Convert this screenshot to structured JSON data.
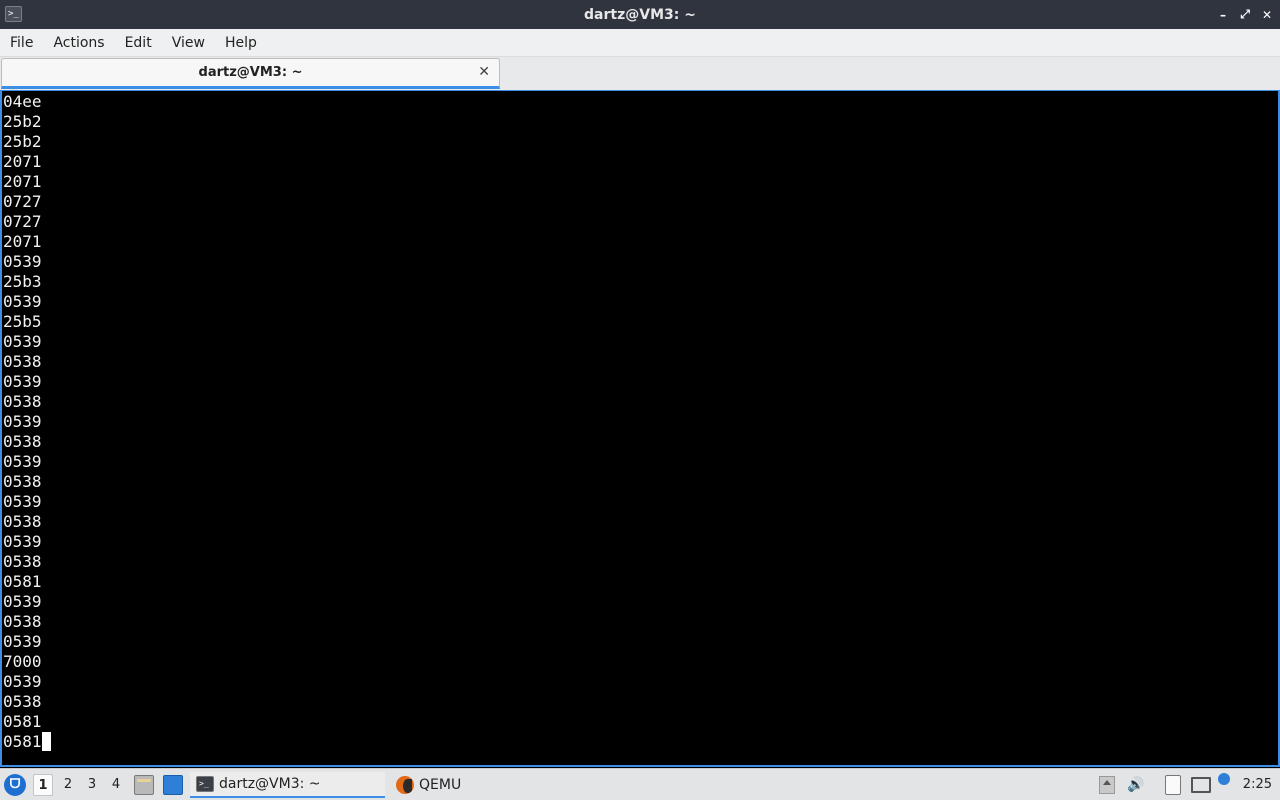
{
  "window": {
    "title": "dartz@VM3: ~",
    "app_icon_glyph": ">_",
    "controls": {
      "minimize": "–",
      "restore": "⤢",
      "close": "✕"
    }
  },
  "menu": [
    "File",
    "Actions",
    "Edit",
    "View",
    "Help"
  ],
  "tab": {
    "label": "dartz@VM3: ~",
    "close": "✕"
  },
  "terminal": {
    "lines": [
      "04ee",
      "25b2",
      "25b2",
      "2071",
      "2071",
      "0727",
      "0727",
      "2071",
      "0539",
      "25b3",
      "0539",
      "25b5",
      "0539",
      "0538",
      "0539",
      "0538",
      "0539",
      "0538",
      "0539",
      "0538",
      "0539",
      "0538",
      "0539",
      "0538",
      "0581",
      "0539",
      "0538",
      "0539",
      "7000",
      "0539",
      "0538",
      "0581",
      "0581"
    ]
  },
  "taskbar": {
    "workspaces": [
      "1",
      "2",
      "3",
      "4"
    ],
    "active_workspace": "1",
    "tasks": [
      {
        "label": "dartz@VM3: ~",
        "icon": "terminal-icon"
      },
      {
        "label": "QEMU",
        "icon": "qemu-icon"
      }
    ],
    "clock": "2:25",
    "accent": "#3d8ee6"
  }
}
